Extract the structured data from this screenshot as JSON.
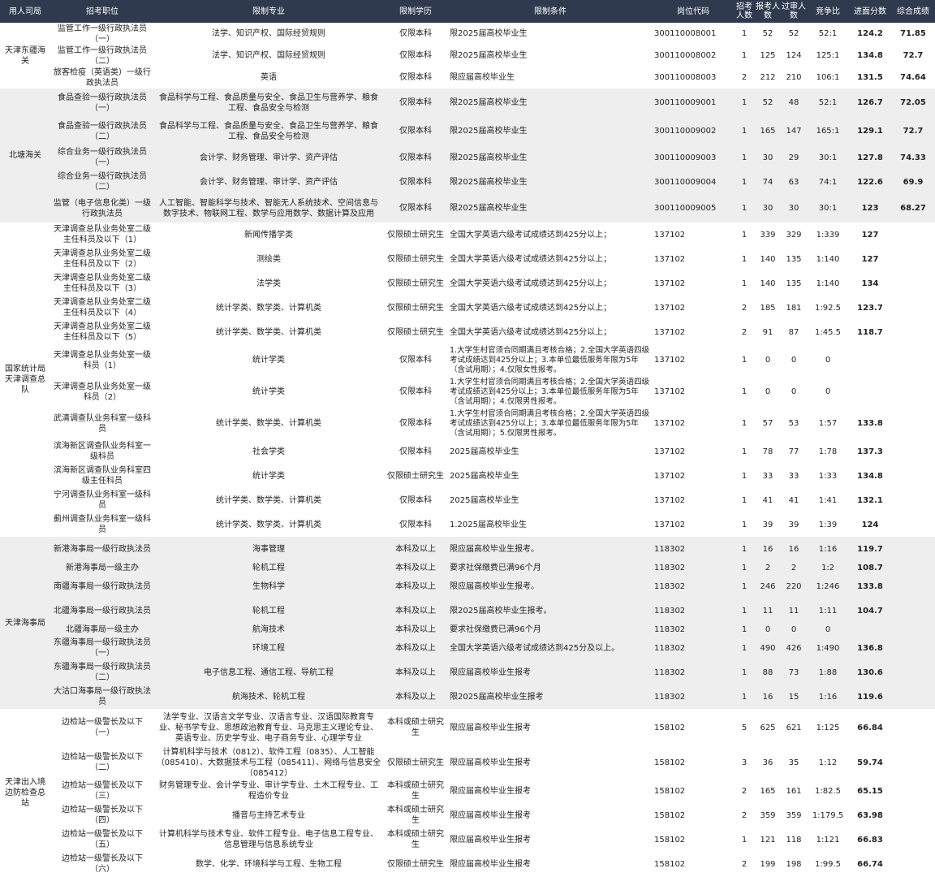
{
  "headers": [
    "用人司局",
    "招考职位",
    "限制专业",
    "限制学历",
    "限制条件",
    "岗位代码",
    "招考人数",
    "报考人数",
    "过审人数",
    "竞争比",
    "进面分数",
    "综合成绩"
  ],
  "groups": [
    {
      "dept": "天津东疆海关",
      "shade": false,
      "rows": [
        {
          "h": 27,
          "pos": "监管工作一级行政执法员（一）",
          "major": "法学、知识产权、国际经贸规则",
          "edu": "仅限本科",
          "cond": "限2025届高校毕业生",
          "code": "300110008001",
          "n": "1",
          "apply": "52",
          "pass": "52",
          "ratio": "52:1",
          "score": "124.2",
          "total": "71.85"
        },
        {
          "h": 27,
          "pos": "监管工作一级行政执法员（二）",
          "major": "法学、知识产权、国际经贸规则",
          "edu": "仅限本科",
          "cond": "限2025届高校毕业生",
          "code": "300110008002",
          "n": "1",
          "apply": "125",
          "pass": "124",
          "ratio": "125:1",
          "score": "134.8",
          "total": "72.7"
        },
        {
          "h": 27,
          "pos": "旅客检疫（英语类）一级行政执法员",
          "major": "英语",
          "edu": "仅限本科",
          "cond": "限应届高校毕业生",
          "code": "300110008003",
          "n": "2",
          "apply": "212",
          "pass": "210",
          "ratio": "106:1",
          "score": "131.5",
          "total": "74.64"
        }
      ]
    },
    {
      "dept": "北塘海关",
      "shade": true,
      "rows": [
        {
          "h": 35,
          "pos": "食品查验一级行政执法员（一）",
          "major": "食品科学与工程、食品质量与安全、食品卫生与营养学、粮食工程、食品安全与检测",
          "edu": "仅限本科",
          "cond": "限2025届高校毕业生",
          "code": "300110009001",
          "n": "1",
          "apply": "52",
          "pass": "48",
          "ratio": "52:1",
          "score": "126.7",
          "total": "72.05"
        },
        {
          "h": 35,
          "pos": "食品查验一级行政执法员（二）",
          "major": "食品科学与工程、食品质量与安全、食品卫生与营养学、粮食工程、食品安全与检测",
          "edu": "仅限本科",
          "cond": "限2025届高校毕业生",
          "code": "300110009002",
          "n": "1",
          "apply": "165",
          "pass": "147",
          "ratio": "165:1",
          "score": "129.1",
          "total": "72.7"
        },
        {
          "h": 30,
          "pos": "综合业务一级行政执法员（一）",
          "major": "会计学、财务管理、审计学、资产评估",
          "edu": "仅限本科",
          "cond": "限2025届高校毕业生",
          "code": "300110009003",
          "n": "1",
          "apply": "30",
          "pass": "29",
          "ratio": "30:1",
          "score": "127.8",
          "total": "74.33"
        },
        {
          "h": 30,
          "pos": "综合业务一级行政执法员（二）",
          "major": "会计学、财务管理、审计学、资产评估",
          "edu": "仅限本科",
          "cond": "限2025届高校毕业生",
          "code": "300110009004",
          "n": "1",
          "apply": "74",
          "pass": "63",
          "ratio": "74:1",
          "score": "122.6",
          "total": "69.9"
        },
        {
          "h": 35,
          "pos": "监管（电子信息化类）一级行政执法员",
          "major": "人工智能、智能科学与技术、智能无人系统技术、空间信息与数字技术、物联网工程、数学与应用数学、数据计算及应用",
          "edu": "仅限本科",
          "cond": "限2025届高校毕业生",
          "code": "300110009005",
          "n": "1",
          "apply": "30",
          "pass": "30",
          "ratio": "30:1",
          "score": "123",
          "total": "68.27"
        }
      ]
    },
    {
      "dept": "国家统计局天津调查总队",
      "shade": false,
      "rows": [
        {
          "h": 30,
          "pos": "天津调查总队业务处室二级主任科员及以下（1）",
          "major": "新闻传播学类",
          "edu": "仅限硕士研究生",
          "cond": "全国大学英语六级考试成绩达到425分以上；",
          "code": "137102",
          "n": "1",
          "apply": "339",
          "pass": "329",
          "ratio": "1:339",
          "score": "127",
          "total": ""
        },
        {
          "h": 30,
          "pos": "天津调查总队业务处室二级主任科员及以下（2）",
          "major": "测绘类",
          "edu": "仅限硕士研究生",
          "cond": "全国大学英语六级考试成绩达到425分以上；",
          "code": "137102",
          "n": "1",
          "apply": "140",
          "pass": "135",
          "ratio": "1:140",
          "score": "127",
          "total": ""
        },
        {
          "h": 30,
          "pos": "天津调查总队业务处室二级主任科员及以下（3）",
          "major": "法学类",
          "edu": "仅限硕士研究生",
          "cond": "全国大学英语六级考试成绩达到425分以上；",
          "code": "137102",
          "n": "1",
          "apply": "140",
          "pass": "135",
          "ratio": "1:140",
          "score": "134",
          "total": ""
        },
        {
          "h": 30,
          "pos": "天津调查总队业务处室二级主任科员及以下（4）",
          "major": "统计学类、数学类、计算机类",
          "edu": "仅限硕士研究生",
          "cond": "全国大学英语六级考试成绩达到425分以上；",
          "code": "137102",
          "n": "2",
          "apply": "185",
          "pass": "181",
          "ratio": "1:92.5",
          "score": "123.7",
          "total": ""
        },
        {
          "h": 30,
          "pos": "天津调查总队业务处室二级主任科员及以下（5）",
          "major": "统计学类、数学类、计算机类",
          "edu": "仅限硕士研究生",
          "cond": "全国大学英语六级考试成绩达到425分以上；",
          "code": "137102",
          "n": "2",
          "apply": "91",
          "pass": "87",
          "ratio": "1:45.5",
          "score": "118.7",
          "total": ""
        },
        {
          "h": 39,
          "pos": "天津调查总队业务处室一级科员（1）",
          "major": "统计学类",
          "edu": "仅限本科",
          "cond": "1.大学生村官须合同期满且考核合格；2.全国大学英语四级考试成绩达到425分以上；3.本单位最低服务年限为5年（含试用期）；4.仅限女性报考。",
          "code": "137102",
          "n": "1",
          "apply": "0",
          "pass": "0",
          "ratio": "0",
          "score": "",
          "total": ""
        },
        {
          "h": 39,
          "pos": "天津调查总队业务处室一级科员（2）",
          "major": "统计学类",
          "edu": "仅限本科",
          "cond": "1.大学生村官须合同期满且考核合格；2.全国大学英语四级考试成绩达到425分以上；3.本单位最低服务年限为5年（含试用期）；4.仅限男性报考。",
          "code": "137102",
          "n": "1",
          "apply": "0",
          "pass": "0",
          "ratio": "0",
          "score": "",
          "total": ""
        },
        {
          "h": 39,
          "pos": "武清调查队业务科室一级科员",
          "major": "统计学类、数学类、计算机类",
          "edu": "仅限本科",
          "cond": "1.大学生村官须合同期满且考核合格；2.全国大学英语四级考试成绩达到425分以上；3.本单位最低服务年限为5年（含试用期）；5.仅限男性报考。",
          "code": "137102",
          "n": "1",
          "apply": "57",
          "pass": "53",
          "ratio": "1:57",
          "score": "133.8",
          "total": ""
        },
        {
          "h": 30,
          "pos": "滨海新区调查队业务科室一级科员",
          "major": "社会学类",
          "edu": "仅限本科",
          "cond": "2025届高校毕业生",
          "code": "137102",
          "n": "1",
          "apply": "78",
          "pass": "77",
          "ratio": "1:78",
          "score": "137.3",
          "total": ""
        },
        {
          "h": 30,
          "pos": "滨海新区调查队业务科室四级主任科员",
          "major": "统计学类",
          "edu": "仅限硕士研究生",
          "cond": "2025届高校毕业生",
          "code": "137102",
          "n": "1",
          "apply": "33",
          "pass": "33",
          "ratio": "1:33",
          "score": "134.8",
          "total": ""
        },
        {
          "h": 30,
          "pos": "宁河调查队业务科室一级科员",
          "major": "统计学类、数学类、计算机类",
          "edu": "仅限本科",
          "cond": "2025届高校毕业生",
          "code": "137102",
          "n": "1",
          "apply": "41",
          "pass": "41",
          "ratio": "1:41",
          "score": "132.1",
          "total": ""
        },
        {
          "h": 30,
          "pos": "蓟州调查队业务科室一级科员",
          "major": "统计学类、数学类、计算机类",
          "edu": "仅限本科",
          "cond": "1.2025届高校毕业生",
          "code": "137102",
          "n": "1",
          "apply": "39",
          "pass": "39",
          "ratio": "1:39",
          "score": "124",
          "total": ""
        }
      ]
    },
    {
      "dept": "天津海事局",
      "shade": true,
      "rows": [
        {
          "h": 30,
          "pos": "新港海事局一级行政执法员",
          "major": "海事管理",
          "edu": "本科及以上",
          "cond": "限应届高校毕业生报考。",
          "code": "118302",
          "n": "1",
          "apply": "16",
          "pass": "16",
          "ratio": "1:16",
          "score": "119.7",
          "total": ""
        },
        {
          "h": 16,
          "pos": "新港海事局一级主办",
          "major": "轮机工程",
          "edu": "本科及以上",
          "cond": "要求社保缴费已满96个月",
          "code": "118302",
          "n": "1",
          "apply": "2",
          "pass": "2",
          "ratio": "1:2",
          "score": "108.7",
          "total": ""
        },
        {
          "h": 30,
          "pos": "南疆海事局一级行政执法员",
          "major": "生物科学",
          "edu": "本科及以上",
          "cond": "限应届高校毕业生报考。",
          "code": "118302",
          "n": "1",
          "apply": "246",
          "pass": "220",
          "ratio": "1:246",
          "score": "133.8",
          "total": ""
        },
        {
          "h": 30,
          "pos": "北疆海事局一级行政执法员",
          "major": "轮机工程",
          "edu": "本科及以上",
          "cond": "限2025届高校毕业生报考。",
          "code": "118302",
          "n": "1",
          "apply": "11",
          "pass": "11",
          "ratio": "1:11",
          "score": "104.7",
          "total": ""
        },
        {
          "h": 16,
          "pos": "北疆海事局一级主办",
          "major": "航海技术",
          "edu": "本科及以上",
          "cond": "要求社保缴费已满96个月",
          "code": "118302",
          "n": "1",
          "apply": "0",
          "pass": "0",
          "ratio": "0",
          "score": "",
          "total": ""
        },
        {
          "h": 30,
          "pos": "东疆海事局一级行政执法员（一）",
          "major": "环境工程",
          "edu": "本科及以上",
          "cond": "全国大学英语六级考试成绩达到425分及以上。",
          "code": "118302",
          "n": "1",
          "apply": "490",
          "pass": "426",
          "ratio": "1:490",
          "score": "136.8",
          "total": ""
        },
        {
          "h": 30,
          "pos": "东疆海事局一级行政执法员（二）",
          "major": "电子信息工程、通信工程、导航工程",
          "edu": "本科及以上",
          "cond": "限应届高校毕业生报考",
          "code": "118302",
          "n": "1",
          "apply": "88",
          "pass": "73",
          "ratio": "1:88",
          "score": "130.6",
          "total": ""
        },
        {
          "h": 30,
          "pos": "大沽口海事局一级行政执法员",
          "major": "航海技术、轮机工程",
          "edu": "本科及以上",
          "cond": "限2025届高校毕业生报考",
          "code": "118302",
          "n": "1",
          "apply": "16",
          "pass": "15",
          "ratio": "1:16",
          "score": "119.6",
          "total": ""
        }
      ]
    },
    {
      "dept": "天津出入境边防检查总站",
      "shade": false,
      "rows": [
        {
          "h": 46,
          "pos": "边检站一级警长及以下（一）",
          "major": "法学专业、汉语言文学专业、汉语言专业、汉语国际教育专业、秘书学专业、思想政治教育专业、马克思主义理论专业、英语专业、历史学专业、电子商务专业、心理学专业",
          "edu": "本科或硕士研究生",
          "cond": "限应届高校毕业生报考",
          "code": "158102",
          "n": "5",
          "apply": "625",
          "pass": "621",
          "ratio": "1:125",
          "score": "66.84",
          "total": ""
        },
        {
          "h": 40,
          "pos": "边检站一级警长及以下（二）",
          "major": "计算机科学与技术（0812）、软件工程（0835）、人工智能（085410）、大数据技术与工程（085411）、网络与信息安全（085412）",
          "edu": "仅限硕士研究生",
          "cond": "限应届高校毕业生报考",
          "code": "158102",
          "n": "3",
          "apply": "36",
          "pass": "35",
          "ratio": "1:12",
          "score": "59.74",
          "total": ""
        },
        {
          "h": 30,
          "pos": "边检站一级警长及以下（三）",
          "major": "财务管理专业、会计学专业、审计学专业、土木工程专业、工程造价专业",
          "edu": "本科或硕士研究生",
          "cond": "限应届高校毕业生报考",
          "code": "158102",
          "n": "2",
          "apply": "165",
          "pass": "161",
          "ratio": "1:82.5",
          "score": "65.15",
          "total": ""
        },
        {
          "h": 30,
          "pos": "边检站一级警长及以下（四）",
          "major": "播音与主持艺术专业",
          "edu": "本科或硕士研究生",
          "cond": "限应届高校毕业生报考",
          "code": "158102",
          "n": "2",
          "apply": "359",
          "pass": "359",
          "ratio": "1:179.5",
          "score": "63.98",
          "total": ""
        },
        {
          "h": 30,
          "pos": "边检站一级警长及以下（五）",
          "major": "计算机科学与技术专业、软件工程专业、电子信息工程专业、信息管理与信息系统专业",
          "edu": "本科或硕士研究生",
          "cond": "限应届高校毕业生报考",
          "code": "158102",
          "n": "1",
          "apply": "121",
          "pass": "118",
          "ratio": "1:121",
          "score": "66.83",
          "total": ""
        },
        {
          "h": 30,
          "pos": "边检站一级警长及以下（六）",
          "major": "数学、化学、环境科学与工程、生物工程",
          "edu": "仅限硕士研究生",
          "cond": "限应届高校毕业生报考",
          "code": "158102",
          "n": "2",
          "apply": "199",
          "pass": "198",
          "ratio": "1:99.5",
          "score": "66.74",
          "total": ""
        }
      ]
    }
  ]
}
